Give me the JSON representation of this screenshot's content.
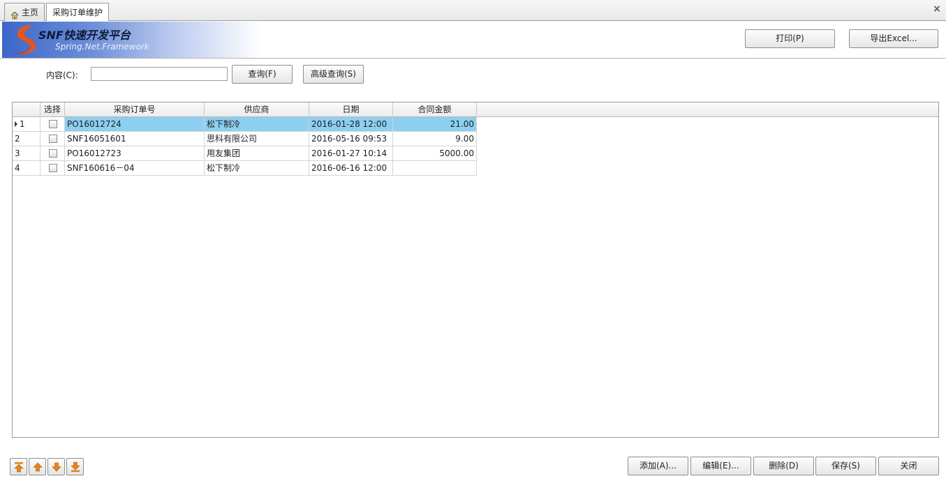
{
  "tabs": [
    {
      "label": "主页",
      "icon": "home-icon"
    },
    {
      "label": "采购订单维护"
    }
  ],
  "close_glyph": "×",
  "logo": {
    "title": "SNF快速开发平台",
    "subtitle": "Spring.Net.Framework"
  },
  "toolbar": {
    "print": "打印(P)",
    "export": "导出Excel..."
  },
  "query": {
    "label": "内容(C):",
    "value": "",
    "search_button": "查询(F)",
    "advanced_button": "高级查询(S)"
  },
  "grid": {
    "columns": [
      "",
      "选择",
      "采购订单号",
      "供应商",
      "日期",
      "合同金额"
    ],
    "rows": [
      {
        "index": "1",
        "order_no": "PO16012724",
        "supplier": "松下制冷",
        "date": "2016-01-28 12:00",
        "amount": "21.00",
        "selected": true
      },
      {
        "index": "2",
        "order_no": "SNF16051601",
        "supplier": "思科有限公司",
        "date": "2016-05-16 09:53",
        "amount": "9.00",
        "selected": false
      },
      {
        "index": "3",
        "order_no": "PO16012723",
        "supplier": "用友集团",
        "date": "2016-01-27 10:14",
        "amount": "5000.00",
        "selected": false
      },
      {
        "index": "4",
        "order_no": "SNF160616－04",
        "supplier": "松下制冷",
        "date": "2016-06-16 12:00",
        "amount": "",
        "selected": false
      }
    ]
  },
  "navigation": [
    "move-first-icon",
    "move-up-icon",
    "move-down-icon",
    "move-last-icon"
  ],
  "actions": {
    "add": "添加(A)...",
    "edit": "编辑(E)...",
    "delete": "删除(D)",
    "save": "保存(S)",
    "close": "关闭"
  },
  "colors": {
    "selected_row": "#8dcff0",
    "logo_blue": "#3b67c9",
    "logo_orange": "#e8541c",
    "nav_orange": "#e8831c"
  }
}
